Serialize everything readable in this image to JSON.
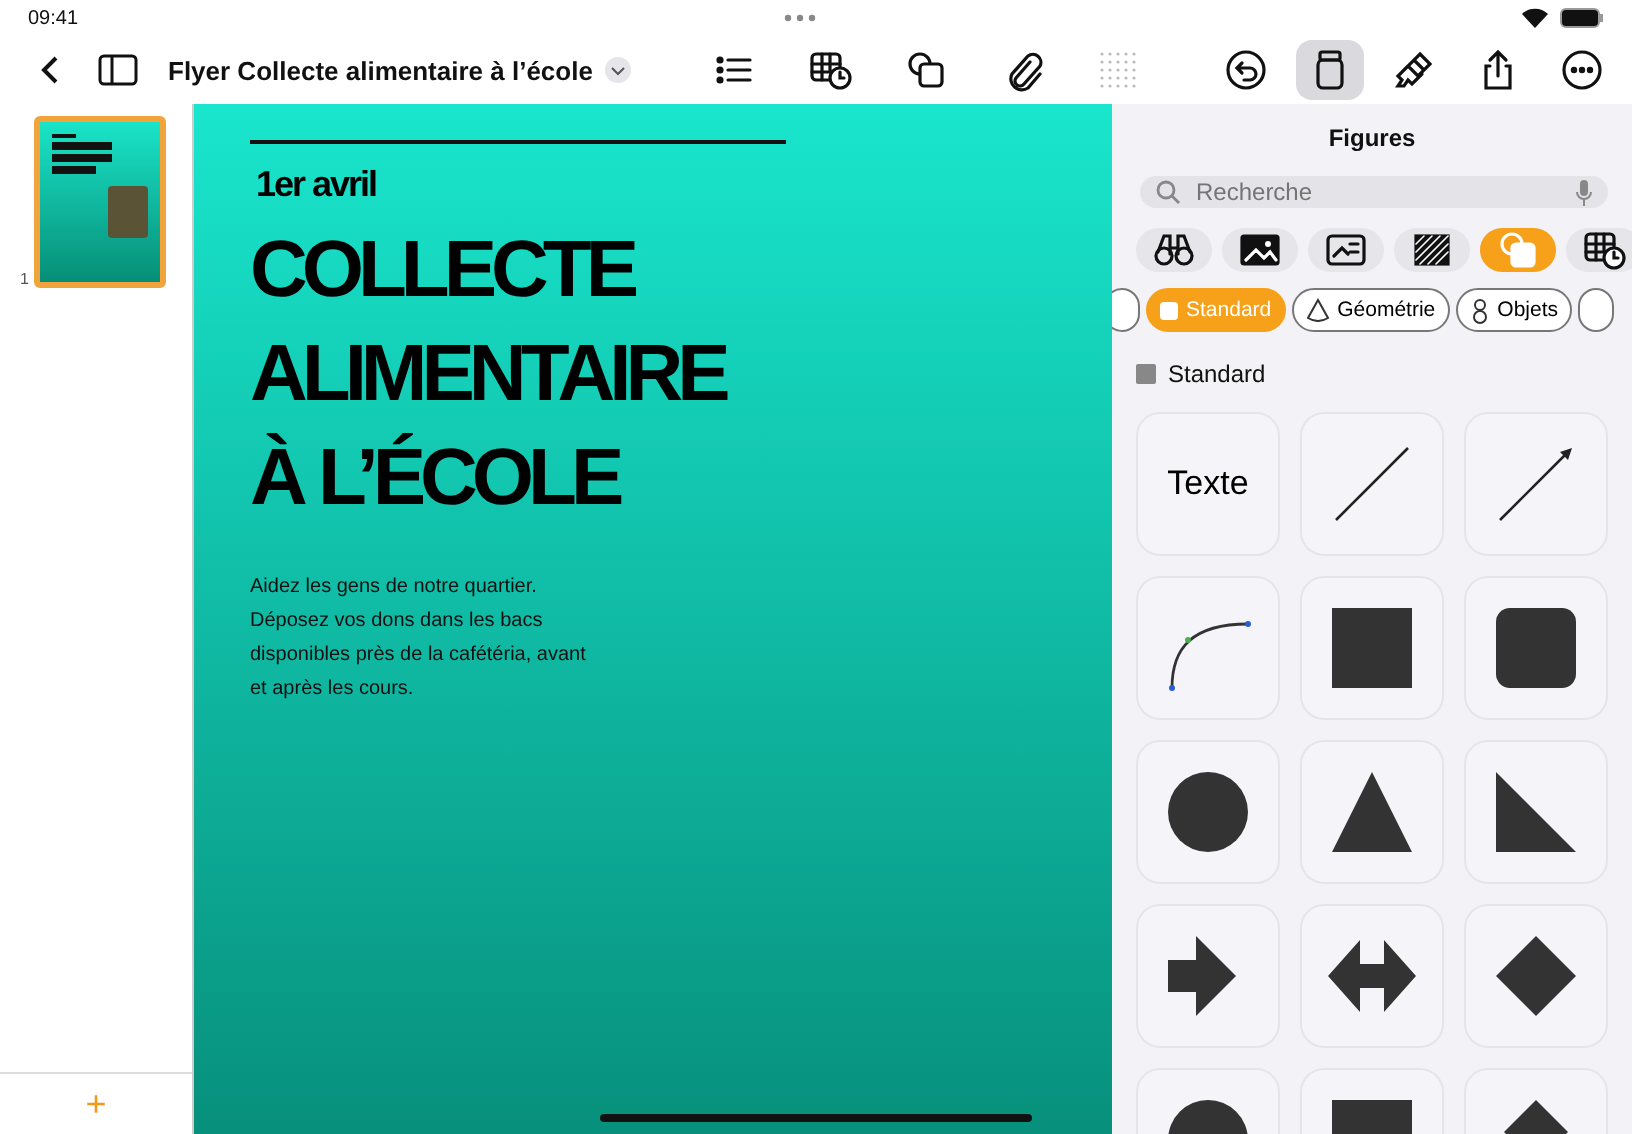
{
  "status_bar": {
    "time": "09:41"
  },
  "toolbar": {
    "title": "Flyer Collecte alimentaire à l’école",
    "center_tools": [
      {
        "kind": "list",
        "disabled": false
      },
      {
        "kind": "table",
        "disabled": false
      },
      {
        "kind": "shapes",
        "disabled": false
      },
      {
        "kind": "clip",
        "disabled": false
      },
      {
        "kind": "grid",
        "disabled": true
      }
    ],
    "right_tools": [
      {
        "kind": "undo",
        "selected": false
      },
      {
        "kind": "format",
        "selected": true
      },
      {
        "kind": "brush",
        "selected": false
      },
      {
        "kind": "share",
        "selected": false
      },
      {
        "kind": "more",
        "selected": false
      }
    ]
  },
  "sidebar": {
    "pages": [
      {
        "number": "1",
        "selected": true
      }
    ],
    "add_label": "+"
  },
  "document": {
    "date": "1er avril",
    "heading": [
      "COLLECTE",
      "ALIMENTAIRE",
      "À L’ÉCOLE"
    ],
    "body": "Aidez les gens de notre quartier. Déposez vos dons dans les bacs disponibles près de la cafétéria, avant et après les cours."
  },
  "panel": {
    "title": "Figures",
    "search": {
      "placeholder": "Recherche"
    },
    "insert_tabs": [
      {
        "kind": "binoculars",
        "selected": false
      },
      {
        "kind": "photo",
        "selected": false
      },
      {
        "kind": "media",
        "selected": false
      },
      {
        "kind": "pattern",
        "selected": false
      },
      {
        "kind": "shapes",
        "selected": true
      },
      {
        "kind": "table",
        "selected": false
      }
    ],
    "categories": [
      {
        "kind": "cut",
        "selected": false
      },
      {
        "kind": "square",
        "label": "Standard",
        "selected": true
      },
      {
        "kind": "cone",
        "label": "Géométrie",
        "selected": false
      },
      {
        "kind": "objects",
        "label": "Objets",
        "selected": false
      },
      {
        "kind": "cut",
        "selected": false
      }
    ],
    "section": "Standard",
    "shapes": [
      {
        "kind": "text",
        "label": "Texte"
      },
      {
        "kind": "line"
      },
      {
        "kind": "arrow-line"
      },
      {
        "kind": "curve"
      },
      {
        "kind": "square"
      },
      {
        "kind": "rounded-square"
      },
      {
        "kind": "circle"
      },
      {
        "kind": "triangle"
      },
      {
        "kind": "right-triangle"
      },
      {
        "kind": "arrow"
      },
      {
        "kind": "double-arrow"
      },
      {
        "kind": "diamond"
      },
      {
        "kind": "half-circle"
      },
      {
        "kind": "rectangle"
      },
      {
        "kind": "peak"
      }
    ]
  }
}
